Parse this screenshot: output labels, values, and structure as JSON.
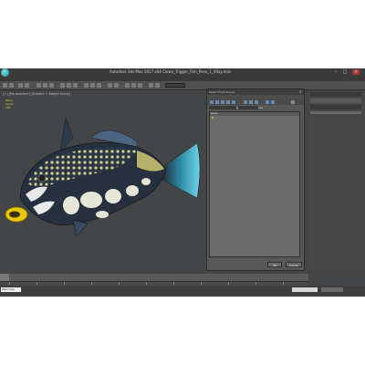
{
  "window": {
    "title": "Autodesk 3ds Max 2017 x64    Clown_Trigger_Fish_Pose_1_VRay.max"
  },
  "menu": {
    "items": [
      "",
      "",
      "",
      "",
      "",
      "",
      "",
      "",
      "",
      "",
      "",
      ""
    ]
  },
  "viewport": {
    "label": "[+] [Perspective] [Shaded + Edged Faces]",
    "stats": [
      "Polys:",
      "Verts:",
      "",
      "FPS:"
    ]
  },
  "dialog": {
    "title": "Select From Scene",
    "menu": [
      "Select",
      "Display",
      "Customize"
    ],
    "list_header": "Name",
    "ok_label": "OK",
    "cancel_label": "Cancel"
  },
  "statusbar": {
    "field_label": "Welcome"
  },
  "colors": {
    "ui_bg": "#444546",
    "fish_skin": "#2b3647",
    "fish_spots": "#cfd08a",
    "tail": "#3fa6c0",
    "lips": "#f0d200"
  }
}
